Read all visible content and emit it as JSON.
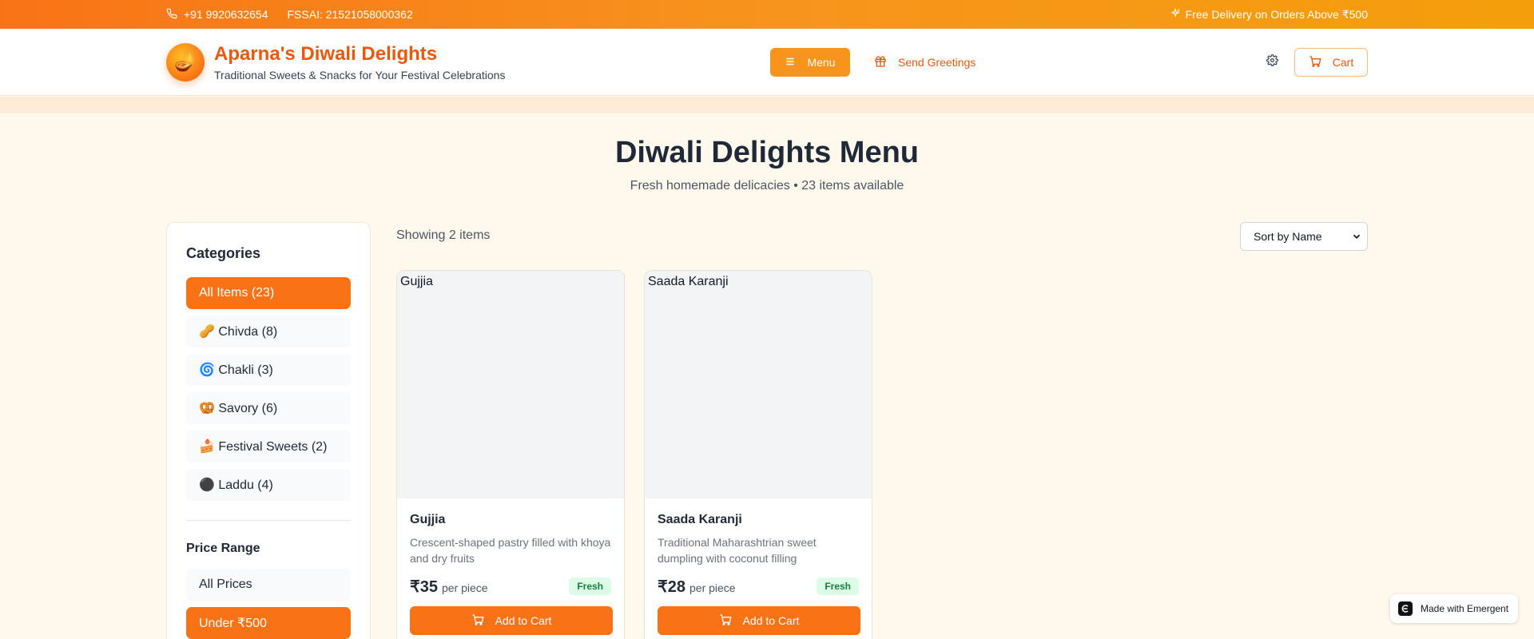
{
  "topbar": {
    "phone": "+91 9920632654",
    "fssai": "FSSAI: 21521058000362",
    "delivery": "Free Delivery on Orders Above ₹500"
  },
  "header": {
    "title": "Aparna's Diwali Delights",
    "subtitle": "Traditional Sweets & Snacks for Your Festival Celebrations",
    "logo_icon": "diya-icon",
    "menu_label": "Menu",
    "greetings_label": "Send Greetings",
    "cart_label": "Cart"
  },
  "hero": {
    "title": "Diwali Delights Menu",
    "subtitle": "Fresh homemade delicacies • 23 items available"
  },
  "sidebar": {
    "categories_heading": "Categories",
    "categories": [
      {
        "label": "All Items (23)",
        "active": true
      },
      {
        "label": "🥜 Chivda (8)",
        "active": false
      },
      {
        "label": "🌀 Chakli (3)",
        "active": false
      },
      {
        "label": "🥨 Savory (6)",
        "active": false
      },
      {
        "label": "🍰 Festival Sweets (2)",
        "active": false
      },
      {
        "label": "⚫ Laddu (4)",
        "active": false
      }
    ],
    "price_heading": "Price Range",
    "prices": [
      {
        "label": "All Prices",
        "active": false
      },
      {
        "label": "Under ₹500",
        "active": true
      }
    ]
  },
  "listing": {
    "showing": "Showing 2 items",
    "sort_selected": "Sort by Name",
    "products": [
      {
        "image_alt": "Gujjia",
        "name": "Gujjia",
        "description": "Crescent-shaped pastry filled with khoya and dry fruits",
        "price": "₹35",
        "unit": "per piece",
        "badge": "Fresh",
        "add_label": "Add to Cart"
      },
      {
        "image_alt": "Saada Karanji",
        "name": "Saada Karanji",
        "description": "Traditional Maharashtrian sweet dumpling with coconut filling",
        "price": "₹28",
        "unit": "per piece",
        "badge": "Fresh",
        "add_label": "Add to Cart"
      }
    ]
  },
  "footer_badge": "Made with Emergent",
  "colors": {
    "accent": "#f97316",
    "accent_dark": "#ea580c",
    "background": "#fff8ec",
    "fresh_badge_bg": "#dcfce7",
    "fresh_badge_text": "#15803d"
  }
}
